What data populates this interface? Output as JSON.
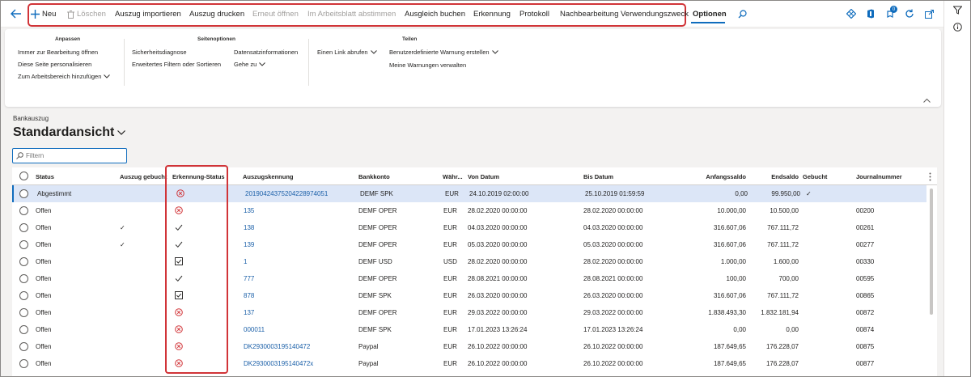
{
  "toolbar": {
    "new": "Neu",
    "delete": "Löschen",
    "import": "Auszug importieren",
    "print": "Auszug drucken",
    "reopen": "Erneut öffnen",
    "reconcile": "Im Arbeitsblatt abstimmen",
    "post": "Ausgleich buchen",
    "recognition": "Erkennung",
    "log": "Protokoll",
    "postprocess": "Nachbearbeitung Verwendungszweck",
    "options": "Optionen",
    "badge_count": "0"
  },
  "ribbon": {
    "groups": {
      "anpassen": "Anpassen",
      "seitenoptionen": "Seitenoptionen",
      "teilen": "Teilen"
    },
    "anpassen_items": [
      "Immer zur Bearbeitung öffnen",
      "Diese Seite personalisieren",
      "Zum Arbeitsbereich hinzufügen"
    ],
    "seiten_items": [
      "Sicherheitsdiagnose",
      "Erweitertes Filtern oder Sortieren",
      "Datensatzinformationen",
      "Gehe zu"
    ],
    "teilen_items": [
      "Einen Link abrufen",
      "Benutzerdefinierte Warnung erstellen",
      "Meine Warnungen verwalten"
    ]
  },
  "page": {
    "caption": "Bankauszug",
    "view": "Standardansicht",
    "filter_placeholder": "Filtern"
  },
  "columns": {
    "status": "Status",
    "booked": "Auszug gebucht",
    "recog": "Erkennung-Status",
    "id": "Auszugskennung",
    "account": "Bankkonto",
    "currency": "Währ...",
    "from": "Von Datum",
    "to": "Bis Datum",
    "opening": "Anfangssaldo",
    "closing": "Endsaldo",
    "posted": "Gebucht",
    "journal": "Journalnummer"
  },
  "rows": [
    {
      "status": "Abgestimmt",
      "booked": "",
      "recog": "error",
      "id": "20190424375204228974051",
      "account": "DEMF SPK",
      "currency": "EUR",
      "from": "24.10.2019 02:00:00",
      "to": "25.10.2019 01:59:59",
      "opening": "0,00",
      "closing": "99.950,00",
      "posted": "✓",
      "journal": ""
    },
    {
      "status": "Offen",
      "booked": "",
      "recog": "error",
      "id": "135",
      "account": "DEMF OPER",
      "currency": "EUR",
      "from": "28.02.2020 00:00:00",
      "to": "28.02.2020 00:00:00",
      "opening": "10.000,00",
      "closing": "10.500,00",
      "posted": "",
      "journal": "00200"
    },
    {
      "status": "Offen",
      "booked": "✓",
      "recog": "check",
      "id": "138",
      "account": "DEMF OPER",
      "currency": "EUR",
      "from": "04.03.2020 00:00:00",
      "to": "04.03.2020 00:00:00",
      "opening": "316.607,06",
      "closing": "767.111,72",
      "posted": "",
      "journal": "00261"
    },
    {
      "status": "Offen",
      "booked": "✓",
      "recog": "check",
      "id": "139",
      "account": "DEMF OPER",
      "currency": "EUR",
      "from": "05.03.2020 00:00:00",
      "to": "05.03.2020 00:00:00",
      "opening": "316.607,06",
      "closing": "767.111,72",
      "posted": "",
      "journal": "00277"
    },
    {
      "status": "Offen",
      "booked": "",
      "recog": "box",
      "id": "1",
      "account": "DEMF USD",
      "currency": "USD",
      "from": "28.02.2020 00:00:00",
      "to": "28.02.2020 00:00:00",
      "opening": "1.000,00",
      "closing": "1.600,00",
      "posted": "",
      "journal": "00330"
    },
    {
      "status": "Offen",
      "booked": "",
      "recog": "check",
      "id": "777",
      "account": "DEMF OPER",
      "currency": "EUR",
      "from": "28.08.2021 00:00:00",
      "to": "28.08.2021 00:00:00",
      "opening": "100,00",
      "closing": "700,00",
      "posted": "",
      "journal": "00595"
    },
    {
      "status": "Offen",
      "booked": "",
      "recog": "box",
      "id": "878",
      "account": "DEMF SPK",
      "currency": "EUR",
      "from": "26.03.2020 00:00:00",
      "to": "26.03.2020 00:00:00",
      "opening": "316.607,06",
      "closing": "767.111,72",
      "posted": "",
      "journal": "00865"
    },
    {
      "status": "Offen",
      "booked": "",
      "recog": "error",
      "id": "137",
      "account": "DEMF OPER",
      "currency": "EUR",
      "from": "29.03.2022 00:00:00",
      "to": "29.03.2022 00:00:00",
      "opening": "1.838.493,30",
      "closing": "1.832.181,94",
      "posted": "",
      "journal": "00872"
    },
    {
      "status": "Offen",
      "booked": "",
      "recog": "error",
      "id": "000011",
      "account": "DEMF SPK",
      "currency": "EUR",
      "from": "17.01.2023 13:26:24",
      "to": "17.01.2023 13:26:24",
      "opening": "0,00",
      "closing": "0,00",
      "posted": "",
      "journal": "00874"
    },
    {
      "status": "Offen",
      "booked": "",
      "recog": "error",
      "id": "DK2930003195140472",
      "account": "Paypal",
      "currency": "EUR",
      "from": "26.10.2022 00:00:00",
      "to": "26.10.2022 00:00:00",
      "opening": "187.649,65",
      "closing": "176.228,07",
      "posted": "",
      "journal": "00875"
    },
    {
      "status": "Offen",
      "booked": "",
      "recog": "error",
      "id": "DK2930003195140472x",
      "account": "Paypal",
      "currency": "EUR",
      "from": "26.10.2022 00:00:00",
      "to": "26.10.2022 00:00:00",
      "opening": "187.649,65",
      "closing": "176.228,07",
      "posted": "",
      "journal": "00877"
    }
  ],
  "colors": {
    "accent": "#0f6cbd",
    "error": "#d13438",
    "highlight": "#d13438",
    "link": "#1a5fa8"
  },
  "icons": [
    "back-arrow-icon",
    "plus-icon",
    "trash-icon",
    "search-icon",
    "diamond-icon",
    "office-icon",
    "notification-icon",
    "refresh-icon",
    "popout-icon",
    "filter-funnel-icon",
    "info-icon",
    "chevron-down-icon",
    "chevron-up-icon",
    "error-circle-icon",
    "checkmark-icon",
    "checkbox-checked-icon",
    "more-vertical-icon"
  ]
}
